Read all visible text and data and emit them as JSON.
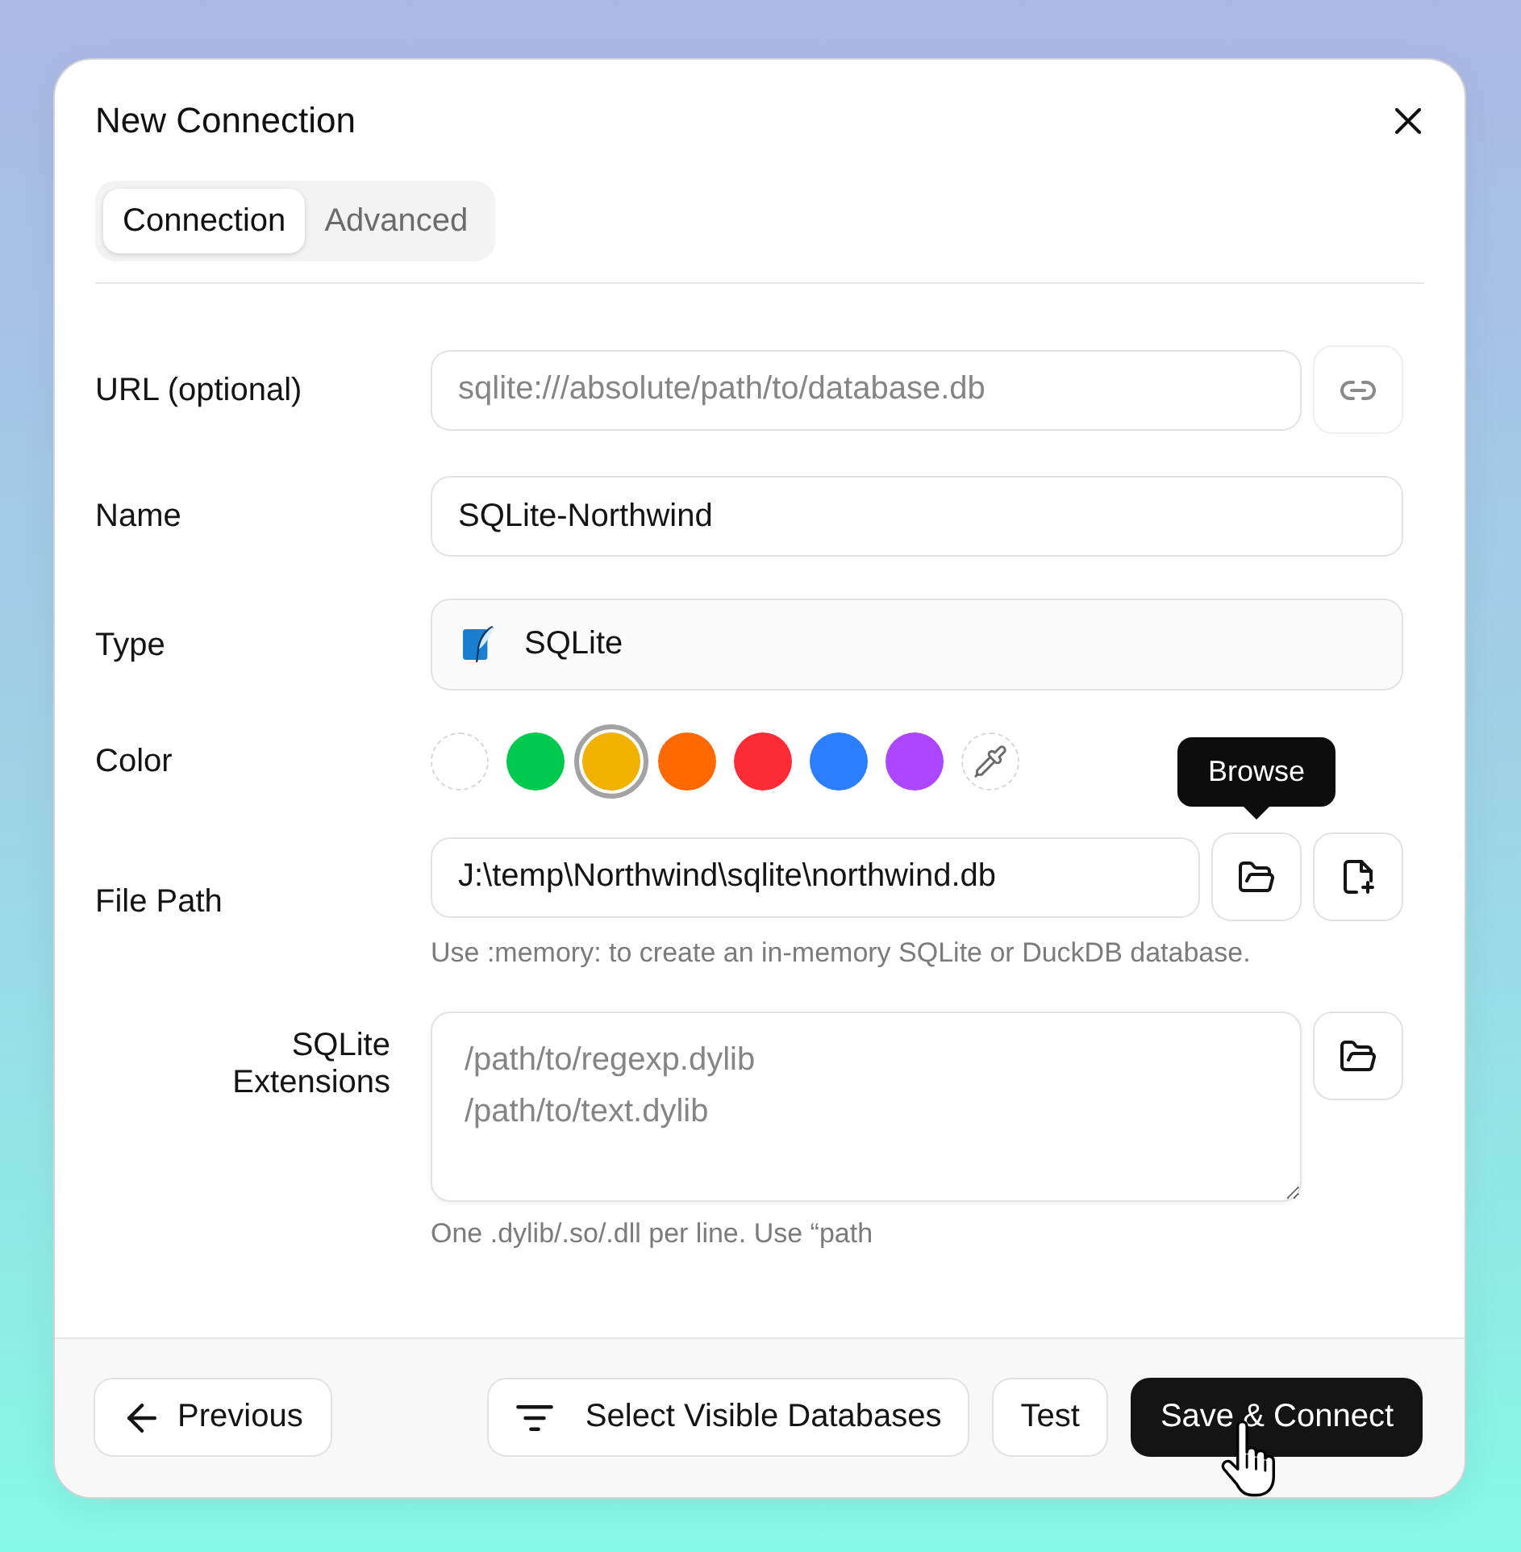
{
  "dialog": {
    "title": "New Connection"
  },
  "tabs": [
    {
      "label": "Connection",
      "selected": true
    },
    {
      "label": "Advanced",
      "selected": false
    }
  ],
  "fields": [
    {
      "kind": "text",
      "label": "URL (optional)",
      "placeholder": "sqlite:///absolute/path/to/database.db",
      "buttons": [
        {
          "kind": "parse",
          "disabled": true
        }
      ]
    },
    {
      "kind": "text",
      "label": "Name",
      "value": "SQLite-Northwind"
    },
    {
      "kind": "select",
      "label": "Type",
      "value": "SQLite"
    },
    {
      "kind": "colors",
      "label": "Color",
      "swatches": [
        {
          "kind": "none",
          "selected": false
        },
        {
          "kind": "color",
          "color": "#00c950",
          "selected": false
        },
        {
          "kind": "color",
          "color": "#f0b100",
          "selected": true
        },
        {
          "kind": "color",
          "color": "#ff6900",
          "selected": false
        },
        {
          "kind": "color",
          "color": "#fb2c36",
          "selected": false
        },
        {
          "kind": "color",
          "color": "#2b7fff",
          "selected": false
        },
        {
          "kind": "color",
          "color": "#ad46ff",
          "selected": false
        },
        {
          "kind": "picker",
          "selected": false
        }
      ]
    },
    {
      "kind": "text",
      "label": "File Path",
      "value": "J:\\temp\\Northwind\\sqlite\\northwind.db",
      "buttons": [
        {
          "kind": "browse",
          "disabled": false,
          "tooltip": "Browse"
        },
        {
          "kind": "new-file",
          "disabled": false
        }
      ],
      "hint": "Use :memory: to create an in-memory SQLite or DuckDB database."
    },
    {
      "kind": "textarea",
      "label": "SQLite Extensions",
      "placeholder": "/path/to/regexp.dylib\n/path/to/text.dylib",
      "buttons": [
        {
          "kind": "browse",
          "disabled": false
        }
      ],
      "hint": "One .dylib/.so/.dll per line. Use “path"
    }
  ],
  "footer": {
    "buttons": [
      {
        "kind": "back",
        "label": "Previous"
      },
      {
        "kind": "filter",
        "label": "Select Visible Databases"
      },
      {
        "kind": "plain",
        "label": "Test"
      },
      {
        "kind": "primary",
        "label": "Save & Connect"
      }
    ]
  }
}
